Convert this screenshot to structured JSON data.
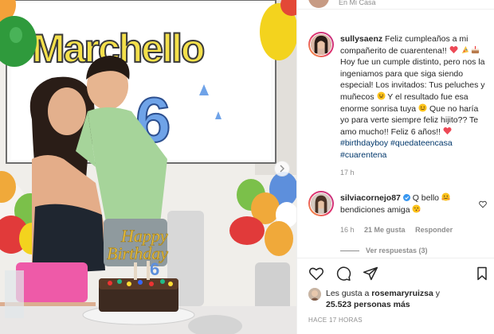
{
  "post": {
    "location": "En Mi Casa",
    "photo_alt": "",
    "banner_text": "Marchello",
    "banner_number": "6",
    "topper_text_1": "Happy",
    "topper_text_2": "Birthday",
    "topper_number": "6"
  },
  "caption": {
    "username": "sullysaenz",
    "text_1": "Feliz cumpleaños a mi compañerito de cuarentena!!",
    "text_2": "Hoy fue un cumple distinto, pero nos la ingeniamos para que siga siendo especial! Los invitados: Tus peluches y muñecos",
    "text_3": "Y el resultado fue esa enorme sonrisa tuya",
    "text_4": "Que no haría yo para verte siempre feliz hijito?? Te amo mucho!! Feliz 6 años!!",
    "hashtag_1": "#birthdayboy",
    "hashtag_2": "#quedateencasa",
    "hashtag_3": "#cuarentena",
    "time": "17 h"
  },
  "comment": {
    "username": "silviacornejo87",
    "text_1": "Q bello",
    "text_2": "bendiciones amiga",
    "time": "16 h",
    "likes": "21 Me gusta",
    "reply_label": "Responder",
    "view_replies": "Ver respuestas (3)"
  },
  "likes": {
    "prefix": "Les gusta a",
    "liker": "rosemaryruizsa",
    "connector": "y",
    "count": "25.523 personas más"
  },
  "post_time": "HACE 17 HORAS",
  "colors": {
    "accent_red": "#ed4956",
    "hashtag": "#00376b",
    "muted": "#8e8e8e",
    "verified": "#3897f0"
  }
}
